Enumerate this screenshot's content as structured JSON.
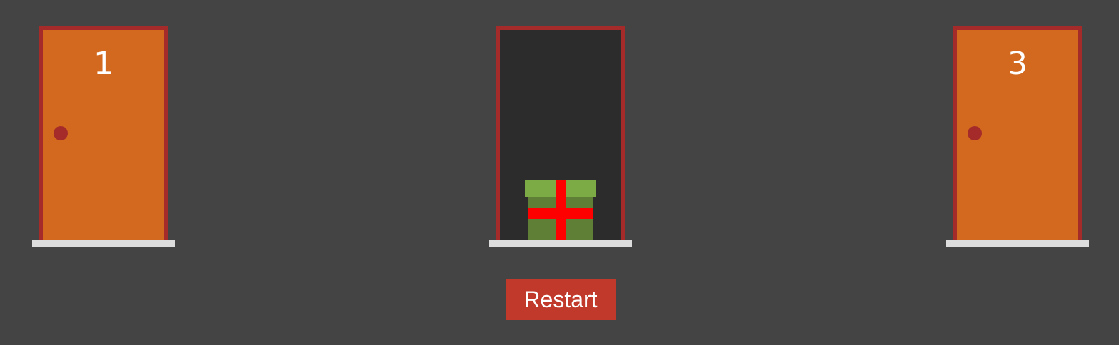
{
  "doors": [
    {
      "number": "1",
      "state": "closed"
    },
    {
      "number": "",
      "state": "open",
      "contents": "gift"
    },
    {
      "number": "3",
      "state": "closed"
    }
  ],
  "colors": {
    "background": "#444444",
    "door": "#d2691e",
    "door_frame": "#a52a2a",
    "door_knob": "#a52a2a",
    "open_doorway": "#2c2c2c",
    "sill": "#dddddd",
    "gift_lid": "#7cab46",
    "gift_box": "#5e7f35",
    "gift_ribbon": "#ff0000",
    "restart_button": "#c0392b"
  },
  "icons": {
    "prize": "gift-icon",
    "knob": "door-knob-icon"
  },
  "restart_label": "Restart"
}
